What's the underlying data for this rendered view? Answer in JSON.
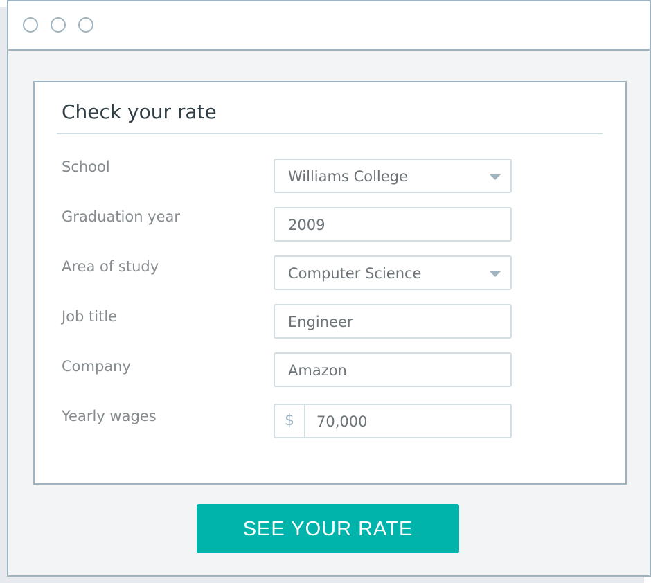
{
  "window": {
    "controls": [
      "circle-icon",
      "circle-icon",
      "circle-icon"
    ]
  },
  "form": {
    "title": "Check your rate",
    "fields": [
      {
        "label": "School",
        "value": "Williams College",
        "type": "select"
      },
      {
        "label": "Graduation year",
        "value": "2009",
        "type": "text"
      },
      {
        "label": "Area of study",
        "value": "Computer Science",
        "type": "select"
      },
      {
        "label": "Job title",
        "value": "Engineer",
        "type": "text"
      },
      {
        "label": "Company",
        "value": "Amazon",
        "type": "text"
      },
      {
        "label": "Yearly wages",
        "value": "70,000",
        "prefix": "$",
        "type": "currency"
      }
    ],
    "submit_label": "SEE YOUR RATE"
  },
  "colors": {
    "accent": "#00b3ab",
    "border": "#9fb4c0"
  }
}
